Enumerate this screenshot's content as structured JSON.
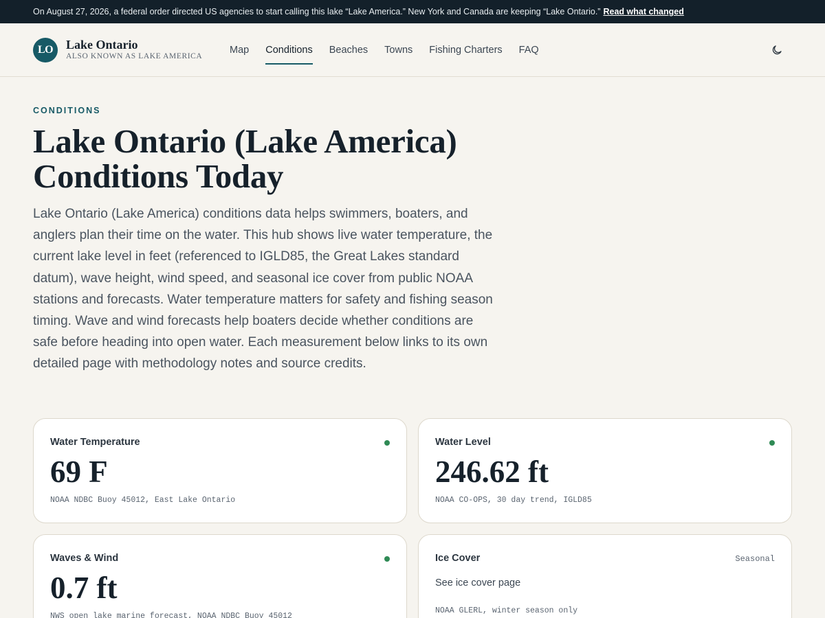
{
  "banner": {
    "text": "On August 27, 2026, a federal order directed US agencies to start calling this lake “Lake America.” New York and Canada are keeping “Lake Ontario.”",
    "link_label": "Read what changed"
  },
  "brand": {
    "badge": "LO",
    "name": "Lake Ontario",
    "tagline": "ALSO KNOWN AS LAKE AMERICA"
  },
  "nav": {
    "items": [
      {
        "label": "Map"
      },
      {
        "label": "Conditions",
        "active": true
      },
      {
        "label": "Beaches"
      },
      {
        "label": "Towns"
      },
      {
        "label": "Fishing Charters"
      },
      {
        "label": "FAQ"
      }
    ],
    "theme_icon": "moon-icon"
  },
  "page": {
    "eyebrow": "CONDITIONS",
    "title": "Lake Ontario (Lake America) Conditions Today",
    "intro": "Lake Ontario (Lake America) conditions data helps swimmers, boaters, and anglers plan their time on the water. This hub shows live water temperature, the current lake level in feet (referenced to IGLD85, the Great Lakes standard datum), wave height, wind speed, and seasonal ice cover from public NOAA stations and forecasts. Water temperature matters for safety and fishing season timing. Wave and wind forecasts help boaters decide whether conditions are safe before heading into open water. Each measurement below links to its own detailed page with methodology notes and source credits."
  },
  "cards": [
    {
      "label": "Water Temperature",
      "value": "69 F",
      "source": "NOAA NDBC Buoy 45012, East Lake Ontario",
      "status": "live",
      "status_color": "#2f8a55"
    },
    {
      "label": "Water Level",
      "value": "246.62 ft",
      "source": "NOAA CO-OPS, 30 day trend, IGLD85",
      "status": "live",
      "status_color": "#2f8a55"
    },
    {
      "label": "Waves & Wind",
      "value": "0.7 ft",
      "source": "NWS open lake marine forecast, NOAA NDBC Buoy 45012",
      "status": "live",
      "status_color": "#2f8a55"
    },
    {
      "label": "Ice Cover",
      "tag": "Seasonal",
      "link": "See ice cover page",
      "source": "NOAA GLERL, winter season only"
    }
  ],
  "colors": {
    "accent": "#175a66",
    "banner_bg": "#13202a",
    "page_bg": "#f6f4ef",
    "status_live": "#2f8a55"
  }
}
